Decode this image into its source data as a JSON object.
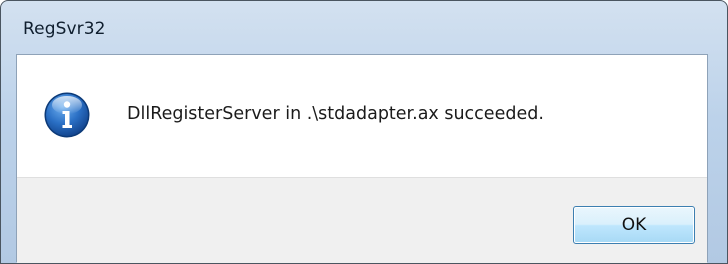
{
  "window": {
    "title": "RegSvr32"
  },
  "dialog": {
    "icon": "information-icon",
    "message": "DllRegisterServer in .\\stdadapter.ax succeeded.",
    "ok_label": "OK"
  },
  "colors": {
    "frame": "#bcd2ea",
    "footer": "#f0f0f0",
    "button_border": "#3c7fb1",
    "icon_blue": "#1d5fb0"
  }
}
